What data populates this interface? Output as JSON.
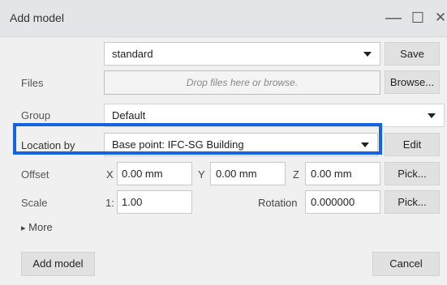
{
  "window": {
    "title": "Add model",
    "minimize_glyph": "—",
    "maximize_glyph": "☐",
    "close_glyph": "✕"
  },
  "template_row": {
    "value": "standard",
    "save_label": "Save"
  },
  "files": {
    "label": "Files",
    "placeholder": "Drop files here or browse.",
    "browse_label": "Browse..."
  },
  "group": {
    "label": "Group",
    "value": "Default"
  },
  "location": {
    "label": "Location by",
    "value": "Base point: IFC-SG Building",
    "edit_label": "Edit"
  },
  "offset": {
    "label": "Offset",
    "x_label": "X",
    "x_value": "0.00 mm",
    "y_label": "Y",
    "y_value": "0.00 mm",
    "z_label": "Z",
    "z_value": "0.00 mm",
    "pick_label": "Pick..."
  },
  "scale": {
    "label": "Scale",
    "prefix": "1:",
    "value": "1.00",
    "rotation_label": "Rotation",
    "rotation_value": "0.000000",
    "pick_label": "Pick..."
  },
  "more": {
    "arrow": "▸",
    "label": "More"
  },
  "footer": {
    "add_label": "Add model",
    "cancel_label": "Cancel"
  },
  "colors": {
    "highlight": "#1463e0"
  }
}
